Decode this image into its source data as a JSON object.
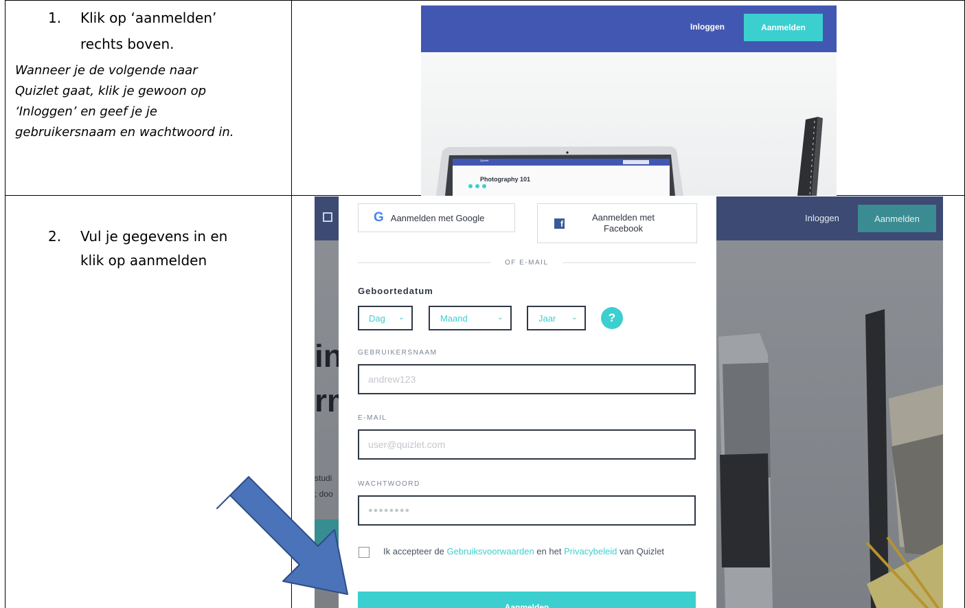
{
  "steps": [
    {
      "number": "1.",
      "lines": [
        "Klik op ‘aanmelden’",
        "rechts boven."
      ],
      "note_lines": [
        "Wanneer je de volgende naar",
        "Quizlet gaat, klik je gewoon op",
        "‘Inloggen’ en geef je je",
        "gebruikersnaam en wachtwoord in."
      ]
    },
    {
      "number": "2.",
      "lines": [
        "Vul je gegevens  in en",
        "klik op  aanmelden"
      ]
    }
  ],
  "screenshot1": {
    "nav": {
      "login": "Inloggen",
      "signup": "Aanmelden"
    },
    "laptop_title": "Photography 101",
    "laptop_brand": "Quizlet"
  },
  "screenshot2": {
    "nav": {
      "login": "Inloggen",
      "signup": "Aanmelden"
    },
    "google_button": "Aanmelden met Google",
    "facebook_button": [
      "Aanmelden met",
      "Facebook"
    ],
    "divider": "OF E-MAIL",
    "birthdate_label": "Geboortedatum",
    "birthdate_selects": [
      "Dag",
      "Maand",
      "Jaar"
    ],
    "help_icon_text": "?",
    "username_label": "GEBRUIKERSNAAM",
    "username_placeholder": "andrew123",
    "email_label": "E-MAIL",
    "email_placeholder": "user@quizlet.com",
    "password_label": "WACHTWOORD",
    "password_placeholder": "●●●●●●●●",
    "terms": {
      "prefix": "Ik accepteer de ",
      "link1": "Gebruiksvoorwaarden",
      "middle": " en het ",
      "link2": "Privacybeleid",
      "suffix": " van Quizlet"
    },
    "submit": "Aanmelden",
    "background_fragments": [
      "in",
      "rm",
      "studi",
      "; doo"
    ]
  },
  "colors": {
    "quizlet_nav": "#4257b2",
    "accent": "#3ccfcf",
    "arrow": "#4a73ba",
    "arrow_border": "#2e4d83"
  }
}
